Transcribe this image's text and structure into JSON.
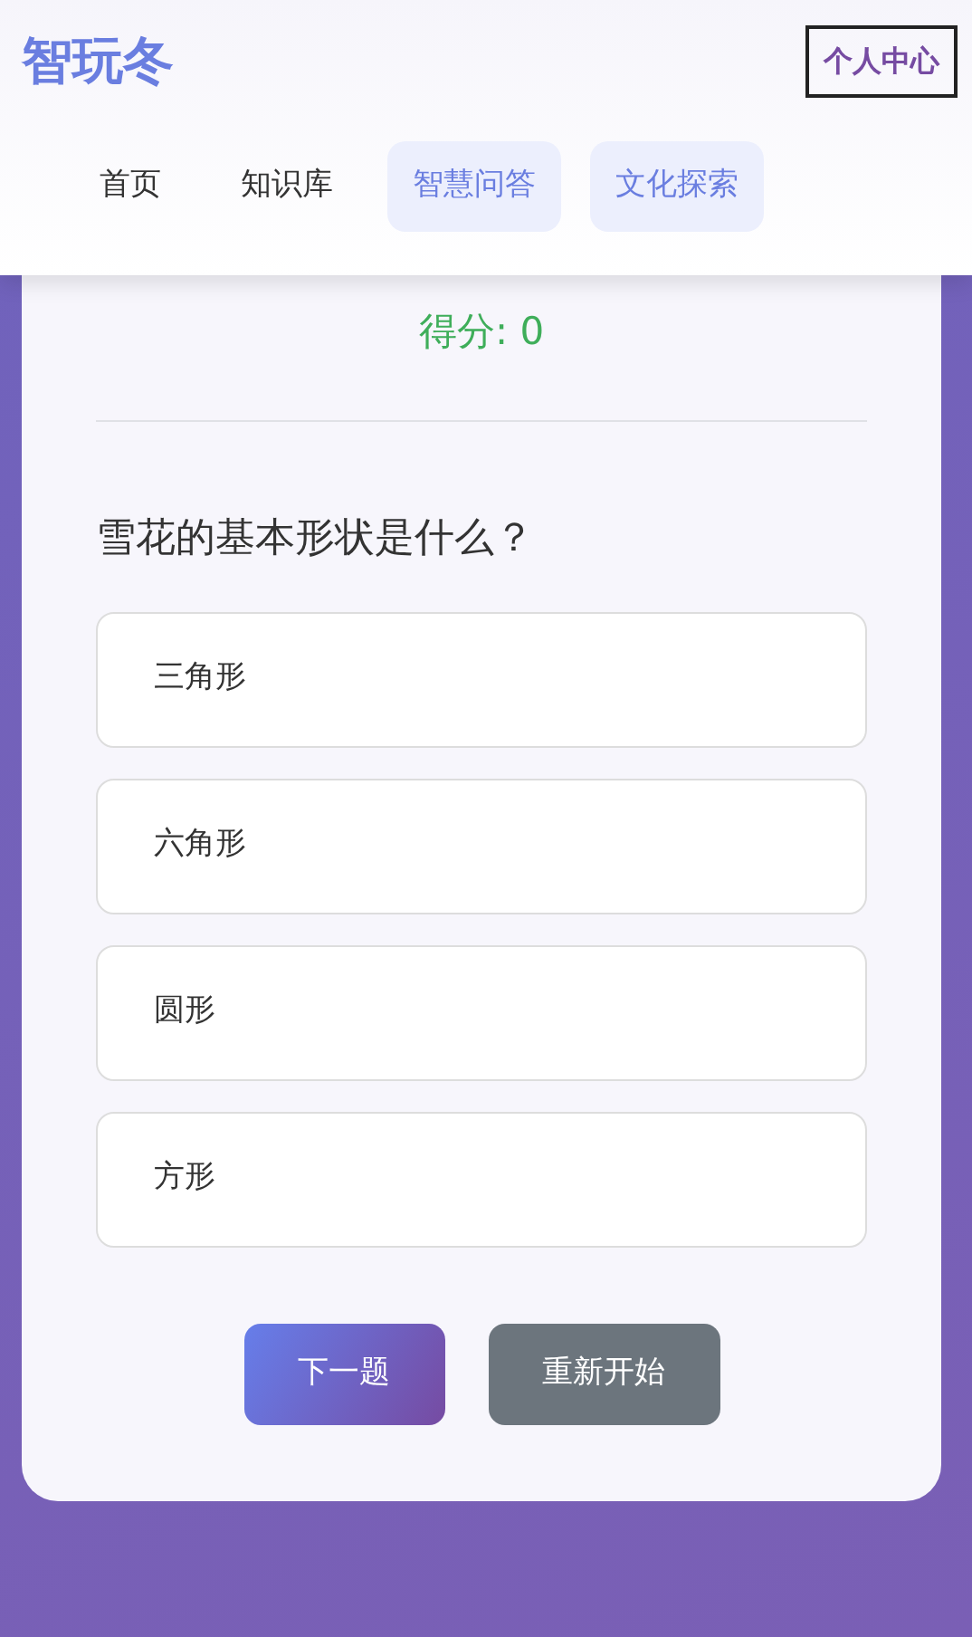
{
  "header": {
    "logo": "智玩冬",
    "profile_button": "个人中心"
  },
  "nav": [
    {
      "label": "首页",
      "selected": false
    },
    {
      "label": "知识库",
      "selected": false
    },
    {
      "label": "智慧问答",
      "selected": true
    },
    {
      "label": "文化探索",
      "selected": true
    }
  ],
  "quiz": {
    "score": "得分: 0",
    "question": "雪花的基本形状是什么？",
    "options": [
      {
        "label": "三角形",
        "selected": false
      },
      {
        "label": "六角形",
        "selected": false
      },
      {
        "label": "圆形",
        "selected": false
      },
      {
        "label": "方形",
        "selected": false
      }
    ],
    "buttons": [
      {
        "label": "下一题",
        "kind": "primary"
      },
      {
        "label": "重新开始",
        "kind": "secondary"
      }
    ]
  }
}
